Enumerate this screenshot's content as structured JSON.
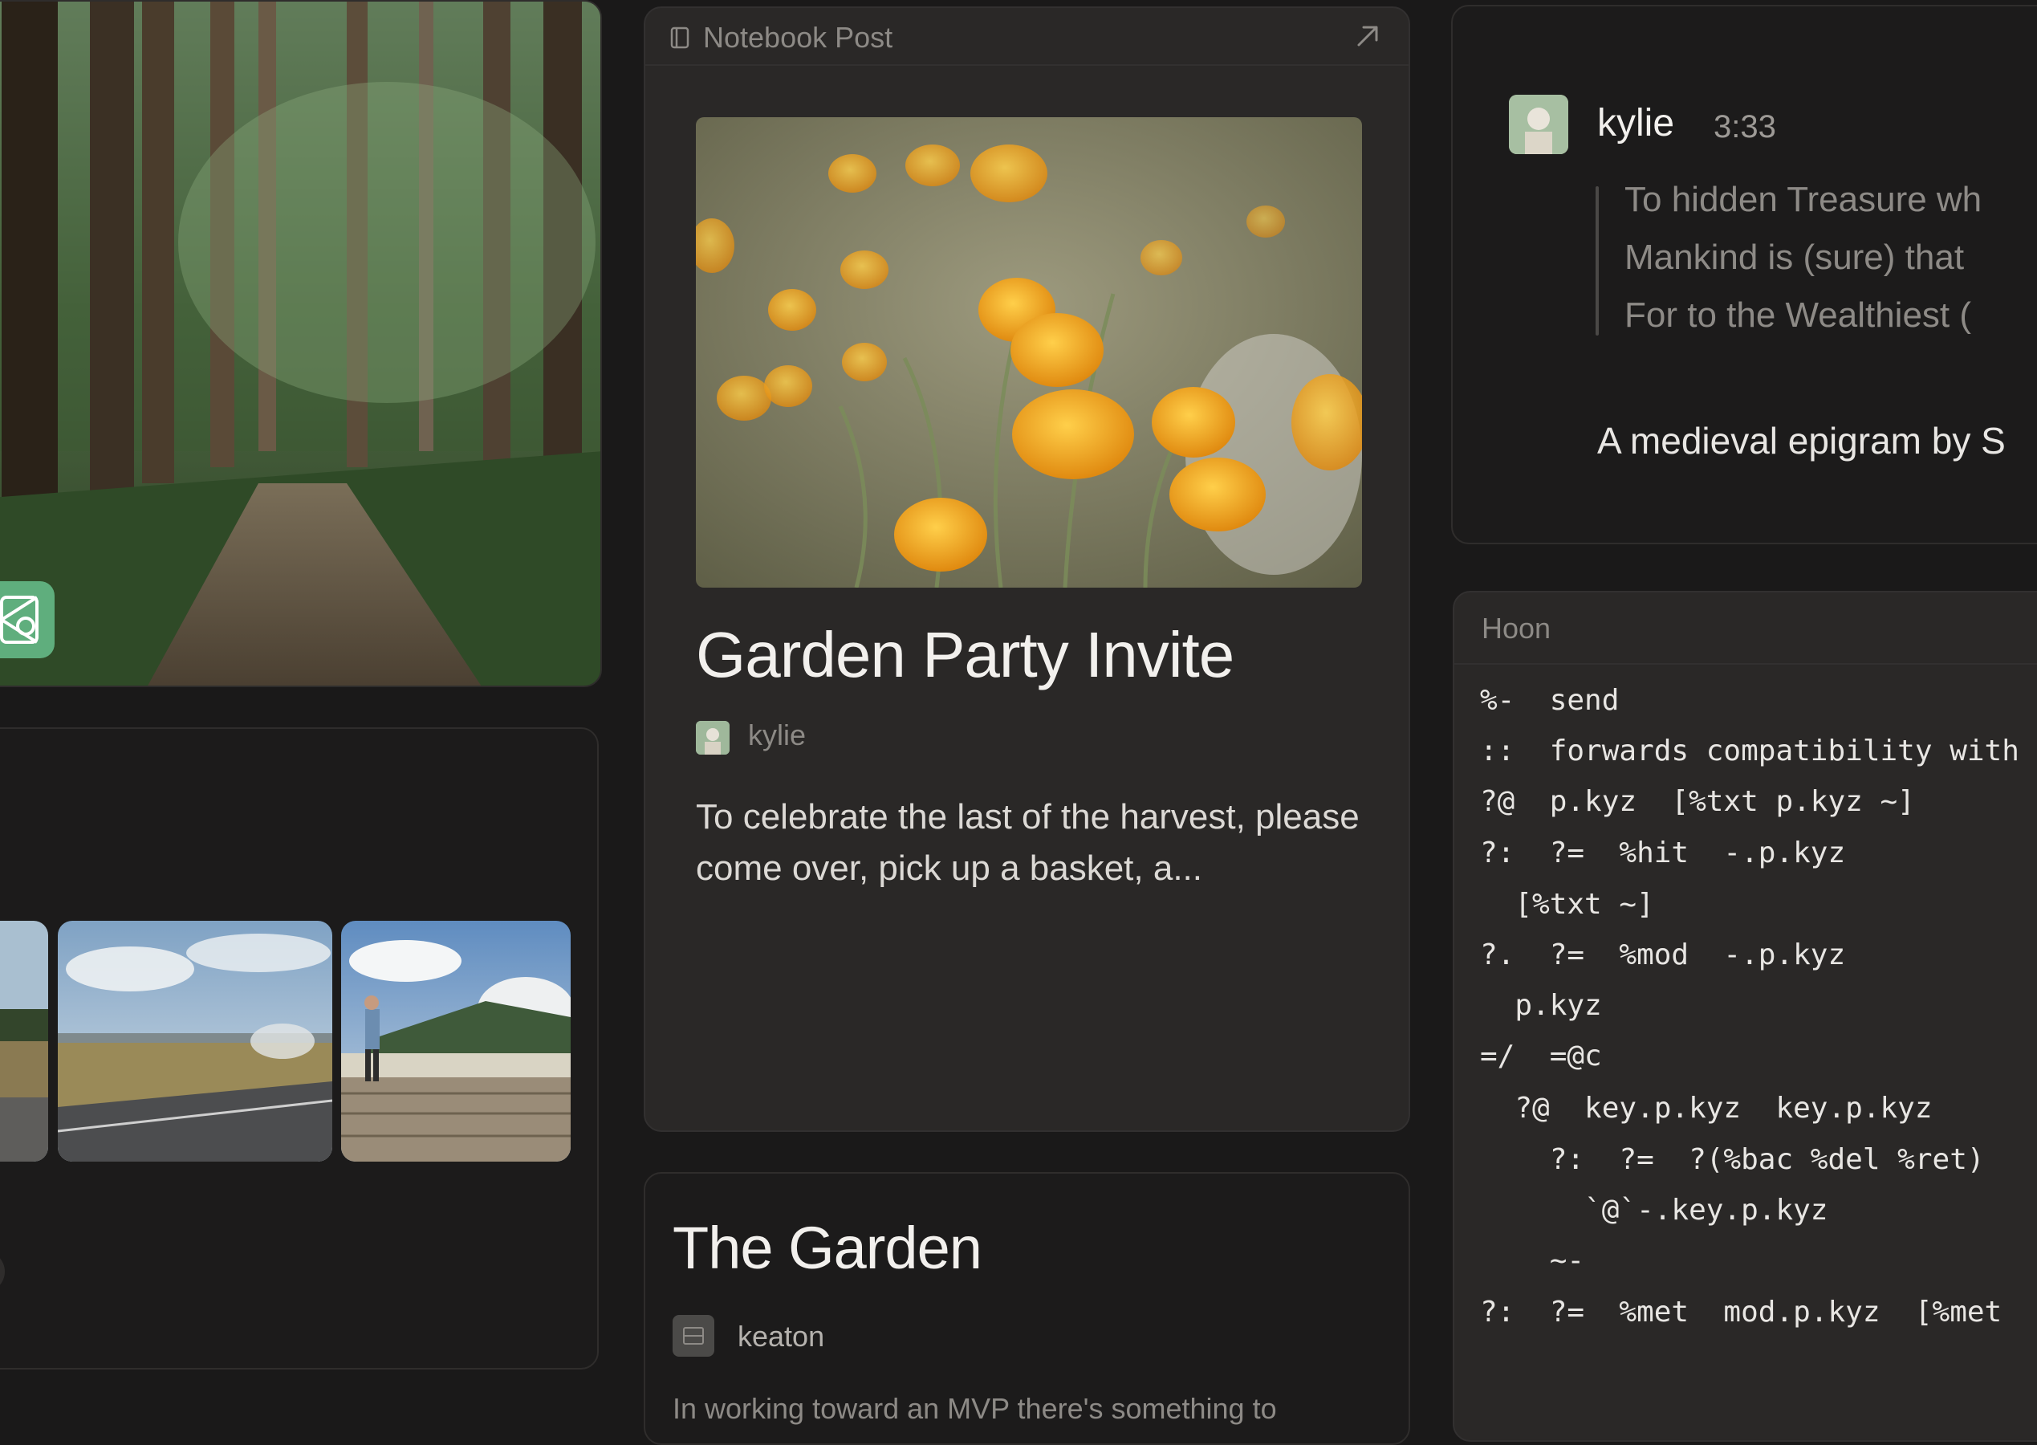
{
  "notebook_post": {
    "header_label": "Notebook Post",
    "title": "Garden Party Invite",
    "author": "kylie",
    "excerpt": "To celebrate the last of the harvest, please come over, pick up a basket, a..."
  },
  "garden_post": {
    "title": "The Garden",
    "author": "keaton",
    "excerpt": "In working toward an MVP there's something to"
  },
  "chat_message": {
    "author": "kylie",
    "time": "3:33",
    "quote_lines": [
      "To hidden Treasure wh",
      "Mankind is (sure) that",
      "For to the Wealthiest ("
    ],
    "body": "A medieval epigram by S"
  },
  "code_block": {
    "language": "Hoon",
    "lines": [
      "%-  send",
      "::  forwards compatibility with",
      "?@  p.kyz  [%txt p.kyz ~]",
      "?:  ?=  %hit  -.p.kyz",
      "  [%txt ~]",
      "?.  ?=  %mod  -.p.kyz",
      "  p.kyz",
      "=/  =@c",
      "  ?@  key.p.kyz  key.p.kyz",
      "    ?:  ?=  ?(%bac %del %ret)",
      "      `@`-.key.p.kyz",
      "    ~-",
      "?:  ?=  %met  mod.p.kyz  [%met"
    ]
  },
  "icons": {
    "notebook": "notebook-icon",
    "open_external": "arrow-up-right-icon",
    "app_badge": "app-tile-icon"
  },
  "colors": {
    "background": "#1a1919",
    "card": "#2a2827",
    "badge_green": "#5fae7d"
  }
}
